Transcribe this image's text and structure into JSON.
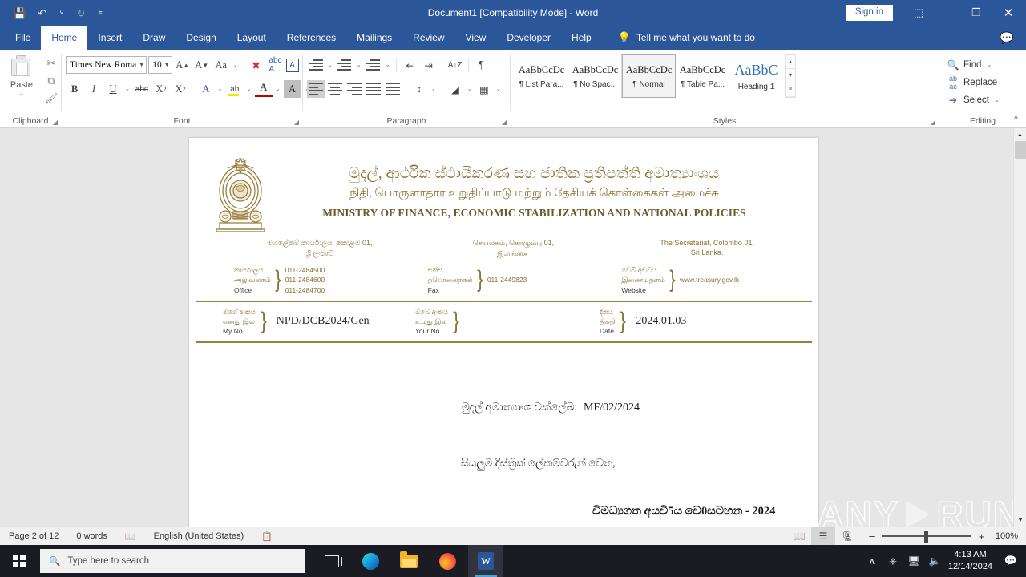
{
  "titlebar": {
    "document_title": "Document1 [Compatibility Mode]  -  Word",
    "signin_label": "Sign in",
    "qat": [
      {
        "name": "save-icon",
        "glyph": "💾"
      },
      {
        "name": "undo-icon",
        "glyph": "↶"
      },
      {
        "name": "undo-dropdown-icon",
        "glyph": "˅"
      },
      {
        "name": "redo-icon",
        "glyph": "↻"
      },
      {
        "name": "customize-qat-icon",
        "glyph": "≡"
      }
    ],
    "window_controls": [
      {
        "name": "ribbon-display-options-icon",
        "glyph": "⬚"
      },
      {
        "name": "minimize-icon",
        "glyph": "—"
      },
      {
        "name": "restore-icon",
        "glyph": "❐"
      },
      {
        "name": "close-icon",
        "glyph": "✕"
      }
    ]
  },
  "tabs": [
    {
      "label": "File",
      "active": false
    },
    {
      "label": "Home",
      "active": true
    },
    {
      "label": "Insert",
      "active": false
    },
    {
      "label": "Draw",
      "active": false
    },
    {
      "label": "Design",
      "active": false
    },
    {
      "label": "Layout",
      "active": false
    },
    {
      "label": "References",
      "active": false
    },
    {
      "label": "Mailings",
      "active": false
    },
    {
      "label": "Review",
      "active": false
    },
    {
      "label": "View",
      "active": false
    },
    {
      "label": "Developer",
      "active": false
    },
    {
      "label": "Help",
      "active": false
    }
  ],
  "tellme": {
    "placeholder": "Tell me what you want to do",
    "icon": "lightbulb-icon"
  },
  "ribbon": {
    "clipboard": {
      "group_label": "Clipboard",
      "paste_label": "Paste",
      "cut_label": "✂",
      "copy_label": "⧉",
      "format_painter_label": "🖌"
    },
    "font": {
      "group_label": "Font",
      "font_name": "Times New Roma",
      "font_size": "10",
      "grow_font": "A",
      "shrink_font": "A",
      "change_case": "Aa",
      "clear_formatting": "🧹",
      "bold": "B",
      "italic": "I",
      "underline": "U",
      "strikethrough": "abc",
      "subscript": "X",
      "superscript": "X",
      "text_effects": "A",
      "highlight": "ab",
      "font_color": "A",
      "phonetic_guide": "A",
      "character_border": "⒨"
    },
    "paragraph": {
      "group_label": "Paragraph",
      "numbering_label": "1 2 3",
      "multilevel_label": "≣",
      "sort_label": "A↓Z",
      "show_marks_label": "¶",
      "line_spacing_label": "↕",
      "shading_label": "◢",
      "borders_label": "▦"
    },
    "styles": {
      "group_label": "Styles",
      "items": [
        {
          "preview": "AaBbCcDc",
          "name": "¶ List Para...",
          "active": false
        },
        {
          "preview": "AaBbCcDc",
          "name": "¶ No Spac...",
          "active": false
        },
        {
          "preview": "AaBbCcDc",
          "name": "¶ Normal",
          "active": true
        },
        {
          "preview": "AaBbCcDc",
          "name": "¶ Table Pa...",
          "active": false
        },
        {
          "preview": "AaBbC",
          "name": "Heading 1",
          "active": false
        }
      ]
    },
    "editing": {
      "group_label": "Editing",
      "find_label": "Find",
      "replace_label": "Replace",
      "select_label": "Select"
    }
  },
  "document": {
    "letterhead": {
      "title_sinhala": "මුදල්, ආර්ථික ස්ථායීකරණ සහ ජාතික ප්‍රතිපත්ති අමාත්‍යාංශය",
      "title_tamil": "நிதி, பொருளாதார உறுதிப்பாடு மற்றும் தேசியக் கொள்கைகள் அமைச்சு",
      "title_english": "MINISTRY OF FINANCE, ECONOMIC STABILIZATION AND NATIONAL POLICIES",
      "emblem_name": "sri-lanka-national-emblem"
    },
    "address": [
      {
        "line1": "මහලේකම් කාර්යාලය, කොළඹ 01,",
        "line2": "ශ්‍රී ලංකාව"
      },
      {
        "line1": "செயலகம், கொழும்பு 01,",
        "line2": "இலங்கை."
      },
      {
        "line1": "The Secretariat, Colombo 01,",
        "line2": "Sri Lanka."
      }
    ],
    "contacts": [
      {
        "labels": [
          "කාර්යාලය",
          "அலுவலகம்",
          "Office"
        ],
        "values": [
          "011-2484500",
          "011-2484600",
          "011-2484700"
        ]
      },
      {
        "labels": [
          "එක්ස්",
          "த௄ொலைநகல்",
          "Fax"
        ],
        "values": [
          "011-2449823"
        ]
      },
      {
        "labels": [
          "වෙබ් අඩවිය",
          "இணையதளம்",
          "Website"
        ],
        "values": [
          "www.treasury.gov.lk"
        ]
      }
    ],
    "reference_row": [
      {
        "labels": [
          "මගේ අංකය",
          "எனது  இல",
          "My No"
        ],
        "value": "NPD/DCB2024/Gen"
      },
      {
        "labels": [
          "ඔබේ අංකය",
          "உமது  இல",
          "Your No"
        ],
        "value": ""
      },
      {
        "labels": [
          "දිනය",
          "திகதி",
          "Date"
        ],
        "value": "2024.01.03"
      }
    ],
    "body": {
      "line1_label": "මුදල් අමාත්‍යාංශ චක්‍ලේඛ:",
      "line1_value": "MF/02/2024",
      "line2": "සියලුම  දිස්ත්‍රික්  ලේකම්වරුන් වෙත,",
      "line3": "විමධ්‍යගත  අයවි5ය  වෙ0සටහන - 2024"
    },
    "watermark": {
      "text_left": "ANY",
      "text_right": "RUN"
    }
  },
  "statusbar": {
    "page_info": "Page 2 of 12",
    "word_count": "0 words",
    "proofing_icon": "proofing-errors-icon",
    "language": "English (United States)",
    "accessibility_icon": "accessibility-checker-icon",
    "views": [
      {
        "name": "read-mode",
        "glyph": "📖",
        "active": false
      },
      {
        "name": "print-layout",
        "glyph": "☰",
        "active": true
      },
      {
        "name": "web-layout",
        "glyph": "🗒",
        "active": false
      }
    ],
    "zoom_out": "−",
    "zoom_in": "+",
    "zoom_level": "100%"
  },
  "taskbar": {
    "search_placeholder": "Type here to search",
    "apps": [
      {
        "name": "task-view-button"
      },
      {
        "name": "microsoft-edge"
      },
      {
        "name": "file-explorer"
      },
      {
        "name": "firefox"
      },
      {
        "name": "microsoft-word",
        "letter": "W",
        "active": true
      }
    ],
    "tray": [
      {
        "name": "show-hidden-icons",
        "glyph": "∧"
      },
      {
        "name": "network-monitor-icon",
        "glyph": "⛶"
      },
      {
        "name": "network-icon",
        "glyph": "🖧"
      },
      {
        "name": "volume-icon",
        "glyph": "🔊"
      }
    ],
    "time": "4:13 AM",
    "date": "12/14/2024",
    "notification_icon": "💬"
  }
}
